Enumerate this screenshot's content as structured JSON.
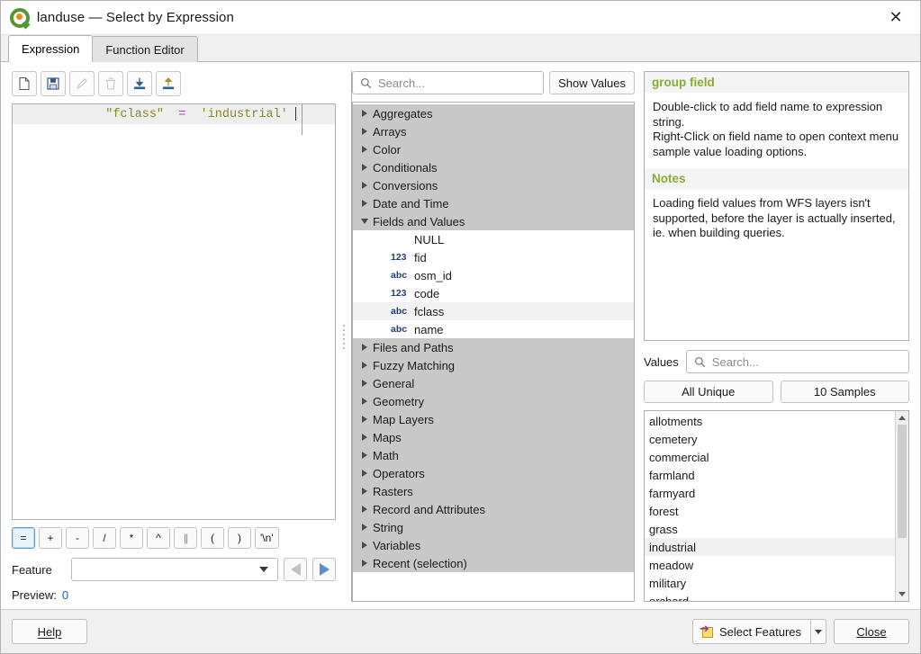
{
  "window": {
    "title": "landuse — Select by Expression",
    "logo_icon": "qgis-logo",
    "close_icon": "✕"
  },
  "tabs": [
    {
      "label": "Expression",
      "active": true
    },
    {
      "label": "Function Editor",
      "active": false
    }
  ],
  "expression_toolbar": [
    {
      "name": "new-expression-icon",
      "enabled": true
    },
    {
      "name": "save-expression-icon",
      "enabled": true
    },
    {
      "name": "edit-expression-icon",
      "enabled": false
    },
    {
      "name": "delete-expression-icon",
      "enabled": false
    },
    {
      "name": "import-expression-icon",
      "enabled": true
    },
    {
      "name": "export-expression-icon",
      "enabled": true
    }
  ],
  "expression": {
    "field_token": "\"fclass\"",
    "operator_token": "=",
    "value_token": "'industrial'",
    "full_text": "\"fclass\"  =  'industrial'"
  },
  "operator_buttons": [
    {
      "label": "=",
      "focused": true
    },
    {
      "label": "+",
      "focused": false
    },
    {
      "label": "-",
      "focused": false
    },
    {
      "label": "/",
      "focused": false
    },
    {
      "label": "*",
      "focused": false
    },
    {
      "label": "^",
      "focused": false
    },
    {
      "label": "||",
      "focused": false
    },
    {
      "label": "(",
      "focused": false
    },
    {
      "label": ")",
      "focused": false
    },
    {
      "label": "'\\n'",
      "focused": false
    }
  ],
  "feature": {
    "label": "Feature",
    "value": "",
    "prev_icon": "previous-feature-icon",
    "next_icon": "next-feature-icon"
  },
  "preview": {
    "label": "Preview:",
    "value": "0"
  },
  "function_panel": {
    "search_placeholder": "Search...",
    "search_value": "",
    "show_values_label": "Show Values",
    "groups": [
      {
        "label": "Aggregates",
        "expanded": false
      },
      {
        "label": "Arrays",
        "expanded": false
      },
      {
        "label": "Color",
        "expanded": false
      },
      {
        "label": "Conditionals",
        "expanded": false
      },
      {
        "label": "Conversions",
        "expanded": false
      },
      {
        "label": "Date and Time",
        "expanded": false
      },
      {
        "label": "Fields and Values",
        "expanded": true
      }
    ],
    "fields": [
      {
        "type": "",
        "label": "NULL",
        "selected": false
      },
      {
        "type": "123",
        "label": "fid",
        "selected": false
      },
      {
        "type": "abc",
        "label": "osm_id",
        "selected": false
      },
      {
        "type": "123",
        "label": "code",
        "selected": false
      },
      {
        "type": "abc",
        "label": "fclass",
        "selected": true
      },
      {
        "type": "abc",
        "label": "name",
        "selected": false
      }
    ],
    "groups_after": [
      {
        "label": "Files and Paths",
        "expanded": false
      },
      {
        "label": "Fuzzy Matching",
        "expanded": false
      },
      {
        "label": "General",
        "expanded": false
      },
      {
        "label": "Geometry",
        "expanded": false
      },
      {
        "label": "Map Layers",
        "expanded": false
      },
      {
        "label": "Maps",
        "expanded": false
      },
      {
        "label": "Math",
        "expanded": false
      },
      {
        "label": "Operators",
        "expanded": false
      },
      {
        "label": "Rasters",
        "expanded": false
      },
      {
        "label": "Record and Attributes",
        "expanded": false
      },
      {
        "label": "String",
        "expanded": false
      },
      {
        "label": "Variables",
        "expanded": false
      },
      {
        "label": "Recent (selection)",
        "expanded": false
      }
    ]
  },
  "help": {
    "title": "group field",
    "paragraph1": "Double-click to add field name to expression string.",
    "paragraph2": "Right-Click on field name to open context menu sample value loading options.",
    "notes_title": "Notes",
    "notes_text": "Loading field values from WFS layers isn't supported, before the layer is actually inserted, ie. when building queries."
  },
  "values": {
    "label": "Values",
    "search_placeholder": "Search...",
    "search_value": "",
    "all_unique_label": "All Unique",
    "samples_label": "10 Samples",
    "items": [
      {
        "label": "allotments",
        "selected": false
      },
      {
        "label": "cemetery",
        "selected": false
      },
      {
        "label": "commercial",
        "selected": false
      },
      {
        "label": "farmland",
        "selected": false
      },
      {
        "label": "farmyard",
        "selected": false
      },
      {
        "label": "forest",
        "selected": false
      },
      {
        "label": "grass",
        "selected": false
      },
      {
        "label": "industrial",
        "selected": true
      },
      {
        "label": "meadow",
        "selected": false
      },
      {
        "label": "military",
        "selected": false
      },
      {
        "label": "orchard",
        "selected": false
      }
    ]
  },
  "footer": {
    "help_label": "Help",
    "select_features_label": "Select Features",
    "close_label": "Close"
  },
  "colors": {
    "accent_green": "#589632",
    "help_heading": "#8aab33",
    "field_token": "#8a8a1f",
    "operator_token": "#a040c0",
    "preview_value": "#1f5fa8",
    "field_type_icon": "#1f3f7a",
    "select_icon_fill": "#f5e06a"
  }
}
